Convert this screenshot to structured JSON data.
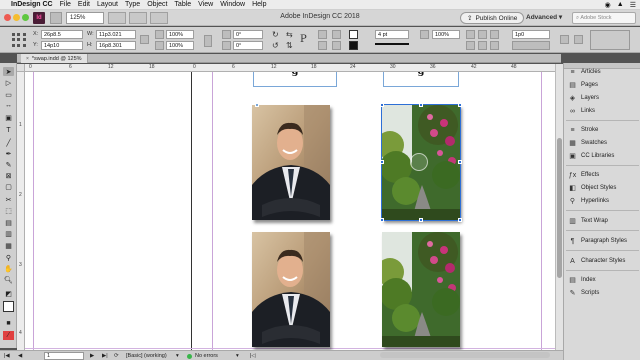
{
  "menubar": {
    "apple": "",
    "app_name": "InDesign CC",
    "items": [
      "File",
      "Edit",
      "Layout",
      "Type",
      "Object",
      "Table",
      "View",
      "Window",
      "Help"
    ],
    "status_icons": [
      "◉",
      "▲",
      "☰"
    ]
  },
  "appbar": {
    "app_icon": "Id",
    "zoom": "125%",
    "title": "Adobe InDesign CC 2018",
    "publish_label": "Publish Online",
    "workspace": "Advanced",
    "stock_placeholder": "Adobe Stock"
  },
  "control": {
    "x_label": "X:",
    "x_value": "26p8.5",
    "y_label": "Y:",
    "y_value": "14p10",
    "w_label": "W:",
    "w_value": "11p3.021",
    "h_label": "H:",
    "h_value": "16p8.301",
    "scale_x": "100%",
    "scale_y": "100%",
    "rotate": "0°",
    "shear": "0°",
    "stroke_weight": "4 pt",
    "opacity": "100%",
    "gap": "1p0"
  },
  "document_tab": {
    "name": "*swap.indd @ 125%",
    "close": "×"
  },
  "ruler": {
    "h_labels": [
      "0",
      "6",
      "12",
      "18",
      "0",
      "6",
      "12",
      "18",
      "24",
      "30",
      "36",
      "42",
      "48"
    ],
    "v_labels": [
      "1",
      "2",
      "3",
      "4"
    ]
  },
  "canvas": {
    "partial_heading": "g"
  },
  "statusbar": {
    "page": "1",
    "style": "[Basic] (working)",
    "preflight": "No errors"
  },
  "panels": [
    {
      "icon": "≡",
      "label": "Articles"
    },
    {
      "icon": "▤",
      "label": "Pages"
    },
    {
      "icon": "◈",
      "label": "Layers"
    },
    {
      "icon": "∞",
      "label": "Links"
    },
    {
      "icon": "≡",
      "label": "Stroke"
    },
    {
      "icon": "▦",
      "label": "Swatches"
    },
    {
      "icon": "▣",
      "label": "CC Libraries"
    },
    {
      "icon": "ƒx",
      "label": "Effects"
    },
    {
      "icon": "◧",
      "label": "Object Styles"
    },
    {
      "icon": "⚲",
      "label": "Hyperlinks"
    },
    {
      "icon": "▥",
      "label": "Text Wrap"
    },
    {
      "icon": "¶",
      "label": "Paragraph Styles"
    },
    {
      "icon": "A",
      "label": "Character Styles"
    },
    {
      "icon": "▤",
      "label": "Index"
    },
    {
      "icon": "✎",
      "label": "Scripts"
    }
  ],
  "colors": {
    "selection": "#2d6fd6",
    "guide": "#c9a4d8",
    "app_icon_bg": "#4a1d36",
    "app_icon_fg": "#ff4fa3"
  }
}
